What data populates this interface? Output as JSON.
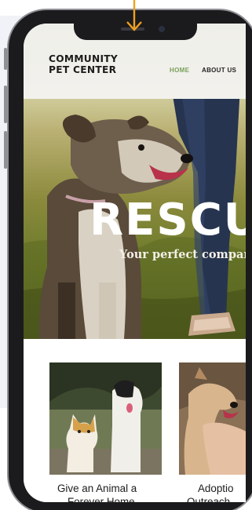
{
  "header": {
    "logo_line1": "COMMUNITY",
    "logo_line2": "PET CENTER",
    "nav": [
      {
        "label": "HOME",
        "active": true
      },
      {
        "label": "ABOUT US",
        "active": false
      }
    ]
  },
  "hero": {
    "title": "RESCU",
    "subtitle": "Your perfect compan"
  },
  "cards": [
    {
      "title_line1": "Give an Animal a",
      "title_line2": "Forever Home",
      "image": "cat-and-dog-photo"
    },
    {
      "title_line1": "Adoptio",
      "title_line2": "Outreach",
      "image": "dog-with-person-photo"
    }
  ],
  "colors": {
    "accent": "#7aa05a",
    "text": "#1c1c1c",
    "arrow": "#f0a020",
    "phone_frame": "#1b1b1d"
  }
}
